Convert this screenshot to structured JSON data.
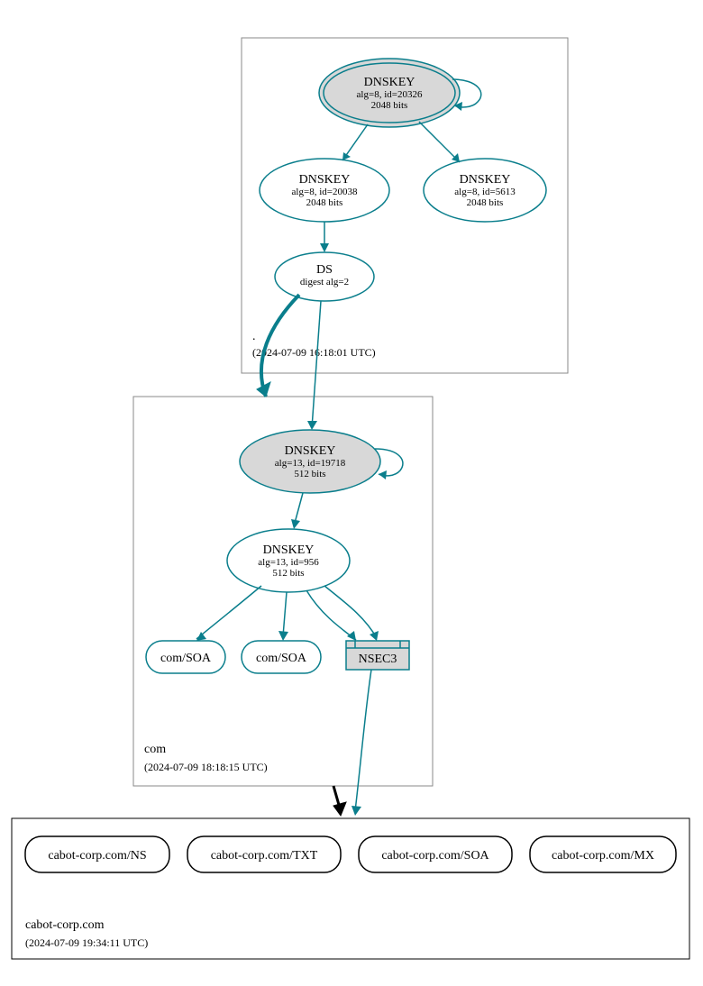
{
  "root_zone": {
    "label": ".",
    "timestamp": "(2024-07-09 16:18:01 UTC)",
    "ksk": {
      "title": "DNSKEY",
      "line1": "alg=8, id=20326",
      "line2": "2048 bits"
    },
    "zsk1": {
      "title": "DNSKEY",
      "line1": "alg=8, id=20038",
      "line2": "2048 bits"
    },
    "zsk2": {
      "title": "DNSKEY",
      "line1": "alg=8, id=5613",
      "line2": "2048 bits"
    },
    "ds": {
      "title": "DS",
      "line1": "digest alg=2"
    }
  },
  "com_zone": {
    "label": "com",
    "timestamp": "(2024-07-09 18:18:15 UTC)",
    "ksk": {
      "title": "DNSKEY",
      "line1": "alg=13, id=19718",
      "line2": "512 bits"
    },
    "zsk": {
      "title": "DNSKEY",
      "line1": "alg=13, id=956",
      "line2": "512 bits"
    },
    "rr1": "com/SOA",
    "rr2": "com/SOA",
    "nsec3": "NSEC3"
  },
  "domain_zone": {
    "label": "cabot-corp.com",
    "timestamp": "(2024-07-09 19:34:11 UTC)",
    "rr1": "cabot-corp.com/NS",
    "rr2": "cabot-corp.com/TXT",
    "rr3": "cabot-corp.com/SOA",
    "rr4": "cabot-corp.com/MX"
  }
}
